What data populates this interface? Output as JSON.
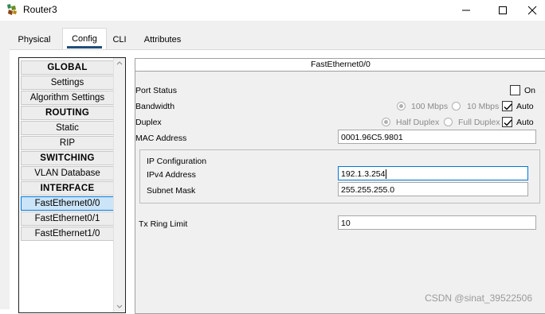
{
  "window": {
    "title": "Router3",
    "icon": "router-device-icon",
    "controls": [
      "minimize-icon",
      "maximize-icon",
      "close-icon"
    ]
  },
  "tabs": [
    {
      "label": "Physical",
      "active": false
    },
    {
      "label": "Config",
      "active": true
    },
    {
      "label": "CLI",
      "active": false
    },
    {
      "label": "Attributes",
      "active": false
    }
  ],
  "nav": {
    "items": [
      {
        "label": "GLOBAL",
        "header": true
      },
      {
        "label": "Settings",
        "header": false
      },
      {
        "label": "Algorithm Settings",
        "header": false
      },
      {
        "label": "ROUTING",
        "header": true
      },
      {
        "label": "Static",
        "header": false
      },
      {
        "label": "RIP",
        "header": false
      },
      {
        "label": "SWITCHING",
        "header": true
      },
      {
        "label": "VLAN Database",
        "header": false
      },
      {
        "label": "INTERFACE",
        "header": true
      },
      {
        "label": "FastEthernet0/0",
        "header": false,
        "selected": true
      },
      {
        "label": "FastEthernet0/1",
        "header": false
      },
      {
        "label": "FastEthernet1/0",
        "header": false
      }
    ]
  },
  "panel": {
    "title": "FastEthernet0/0",
    "port_status": {
      "label": "Port Status",
      "on_label": "On",
      "on_checked": false
    },
    "bandwidth": {
      "label": "Bandwidth",
      "opt1": "100 Mbps",
      "opt2": "10 Mbps",
      "auto_label": "Auto",
      "auto_checked": true
    },
    "duplex": {
      "label": "Duplex",
      "opt1": "Half Duplex",
      "opt2": "Full Duplex",
      "auto_label": "Auto",
      "auto_checked": true
    },
    "mac": {
      "label": "MAC Address",
      "value": "0001.96C5.9801"
    },
    "ip_config": {
      "title": "IP Configuration",
      "ipv4_label": "IPv4 Address",
      "ipv4_value": "192.1.3.254",
      "mask_label": "Subnet Mask",
      "mask_value": "255.255.255.0"
    },
    "tx_ring": {
      "label": "Tx Ring Limit",
      "value": "10"
    }
  },
  "watermark": "CSDN @sinat_39522506",
  "colors": {
    "accent": "#0078d7",
    "tab_underline": "#1f4e79",
    "selection": "#cce4f7"
  }
}
